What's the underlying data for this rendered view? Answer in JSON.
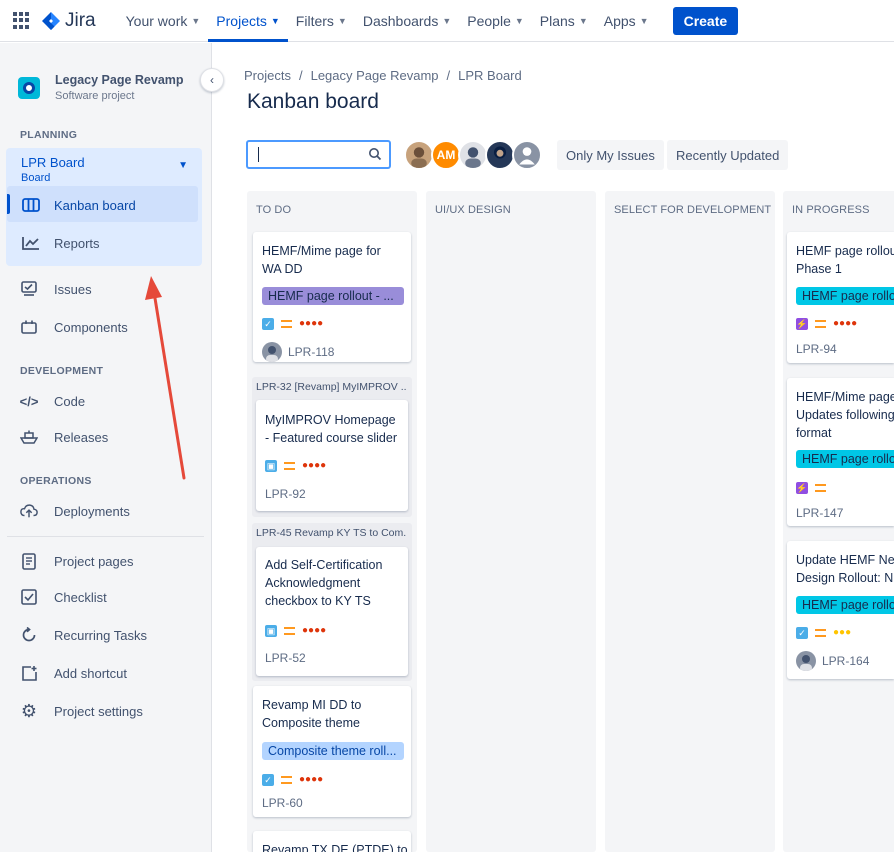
{
  "nav": {
    "logo_text": "Jira",
    "items": [
      {
        "label": "Your work",
        "active": false
      },
      {
        "label": "Projects",
        "active": true
      },
      {
        "label": "Filters",
        "active": false
      },
      {
        "label": "Dashboards",
        "active": false
      },
      {
        "label": "People",
        "active": false
      },
      {
        "label": "Plans",
        "active": false
      },
      {
        "label": "Apps",
        "active": false
      }
    ],
    "create_label": "Create"
  },
  "sidebar": {
    "project_name": "Legacy Page Revamp",
    "project_type": "Software project",
    "planning_label": "PLANNING",
    "board_title": "LPR Board",
    "board_sub": "Board",
    "kanban_label": "Kanban board",
    "reports_label": "Reports",
    "issues_label": "Issues",
    "components_label": "Components",
    "development_label": "DEVELOPMENT",
    "code_label": "Code",
    "releases_label": "Releases",
    "operations_label": "OPERATIONS",
    "deployments_label": "Deployments",
    "project_pages_label": "Project pages",
    "checklist_label": "Checklist",
    "recurring_label": "Recurring Tasks",
    "add_shortcut_label": "Add shortcut",
    "settings_label": "Project settings"
  },
  "main": {
    "breadcrumb": [
      "Projects",
      "Legacy Page Revamp",
      "LPR Board"
    ],
    "title": "Kanban board",
    "search_value": "",
    "avatar_initials": "AM",
    "only_my_issues": "Only My Issues",
    "recently_updated": "Recently Updated"
  },
  "columns": {
    "todo": "TO DO",
    "uiux": "UI/UX DESIGN",
    "select": "SELECT FOR DEVELOPMENT",
    "inprogress": "IN PROGRESS"
  },
  "cards": {
    "c118": {
      "title1": "HEMF/Mime page for",
      "title2": "WA DD",
      "epic": "HEMF page rollout - ...",
      "key": "LPR-118"
    },
    "p32": {
      "label": "LPR-32 [Revamp] MyIMPROV ..."
    },
    "c92": {
      "title1": "MyIMPROV Homepage",
      "title2": "- Featured course slider",
      "key": "LPR-92"
    },
    "p45": {
      "label": "LPR-45 Revamp KY TS to Com..."
    },
    "c52": {
      "title1": "Add Self-Certification",
      "title2": "Acknowledgment",
      "title3": "checkbox to KY TS",
      "key": "LPR-52"
    },
    "c60": {
      "title1": "Revamp MI DD to",
      "title2": "Composite theme",
      "epic": "Composite theme roll...",
      "key": "LPR-60"
    },
    "c_next": {
      "title1": "Revamp TX DE (PTDE) to"
    },
    "c94": {
      "title1": "HEMF page rollou",
      "title2": "Phase 1",
      "epic": "HEMF page rollo",
      "key": "LPR-94"
    },
    "c147": {
      "title1": "HEMF/Mime page",
      "title2": "Updates following",
      "title3": "format",
      "epic": "HEMF page rollo",
      "key": "LPR-147"
    },
    "c164": {
      "title1": "Update HEMF Ne",
      "title2": "Design Rollout: N",
      "epic": "HEMF page rollo",
      "key": "LPR-164"
    }
  },
  "colors": {
    "accent": "#0052cc",
    "epic_purple": "#998dd9",
    "epic_teal": "#00c7e6",
    "epic_lightblue": "#b3d4ff",
    "arrow": "#e5493a"
  }
}
